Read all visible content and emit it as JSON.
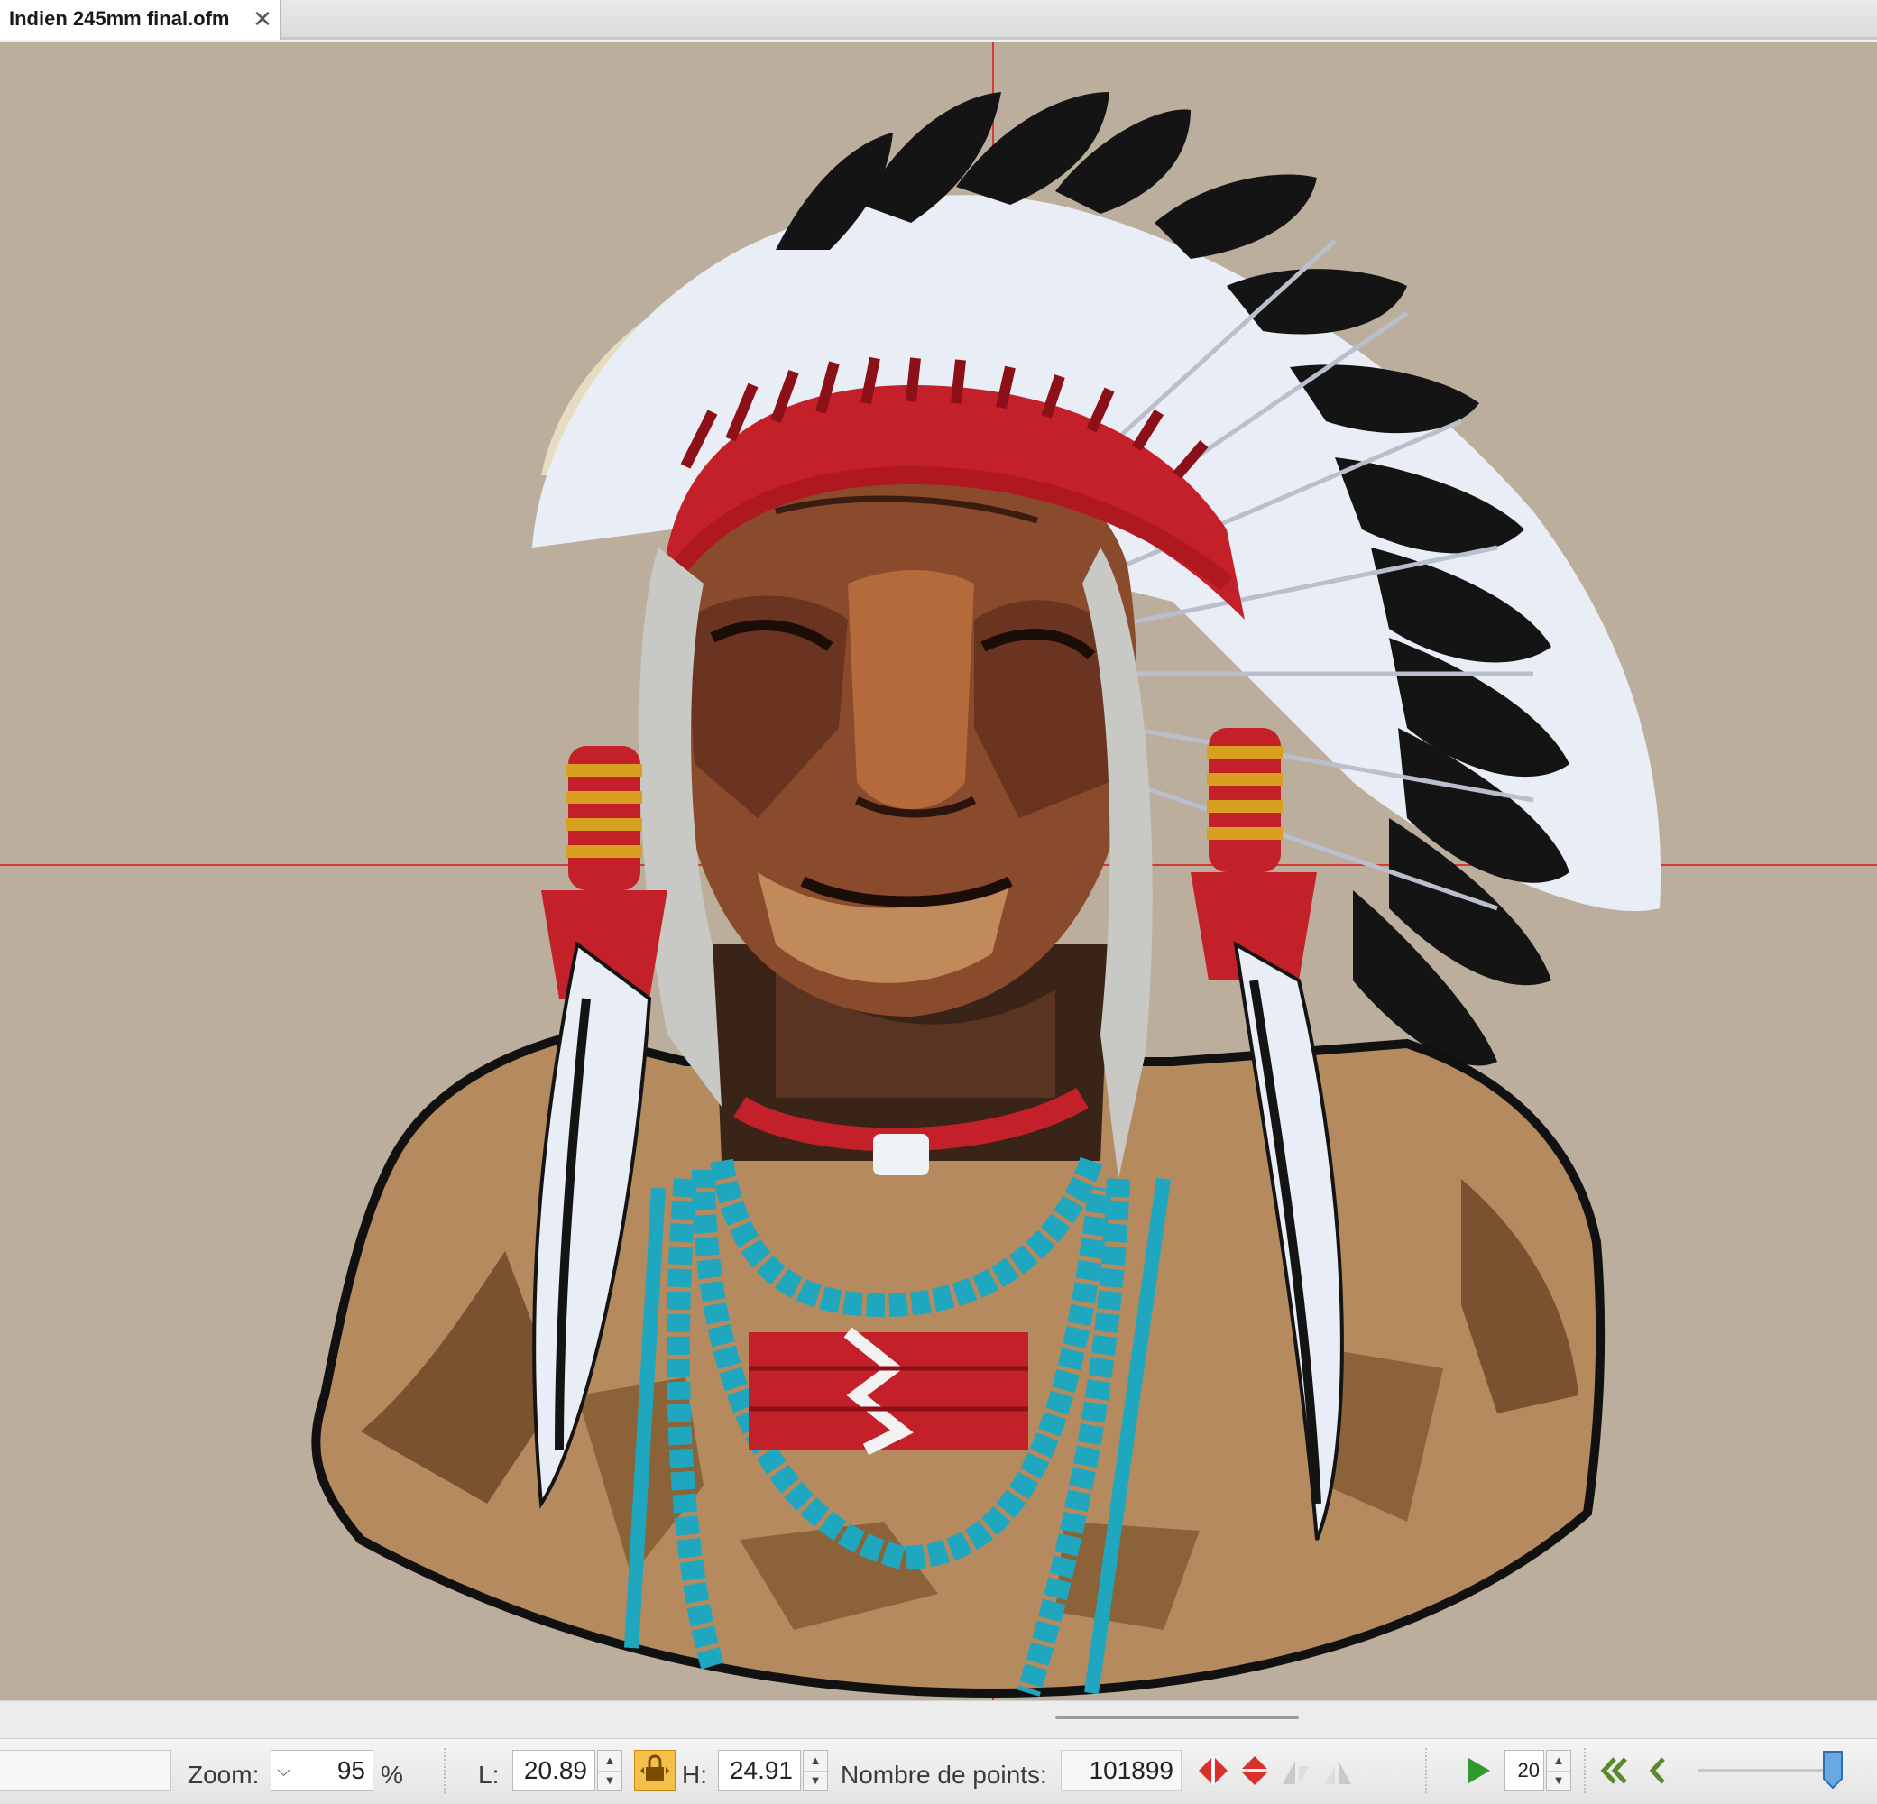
{
  "document_tab": {
    "title": "Indien 245mm final.ofm",
    "close_icon": "close-icon"
  },
  "canvas": {
    "background_color": "#bbae9c",
    "guide_color": "#d23a32",
    "design": "embroidery portrait of a Native American chief in feathered headdress"
  },
  "statusbar": {
    "zoom_label": "Zoom:",
    "zoom_value": "95",
    "zoom_unit": "%",
    "width_label": "L:",
    "width_value": "20.89",
    "height_label": "H:",
    "height_value": "24.91",
    "points_label": "Nombre de points:",
    "points_value": "101899",
    "step_value": "20",
    "icons": [
      "flip-horizontal-icon",
      "flip-vertical-icon",
      "mirror-left-icon",
      "mirror-right-icon",
      "play-icon",
      "rewind-icon",
      "step-back-icon",
      "slider-handle-icon",
      "lock-ratio-icon"
    ]
  },
  "colors": {
    "feather_white": "#eef1f7",
    "feather_black": "#141414",
    "red": "#c3202a",
    "turquoise": "#1fa7bf",
    "skin": "#8a4a2c",
    "tan": "#b48a5e",
    "play_green": "#2f9a2f"
  }
}
